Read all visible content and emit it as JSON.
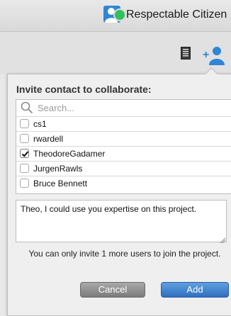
{
  "header": {
    "user_name": "Respectable Citizen",
    "status_color": "#2fc25b",
    "avatar_icon": "user-icon"
  },
  "toolbar": {
    "document_icon": "document-icon",
    "add_user_icon": "add-user-icon"
  },
  "invite_panel": {
    "title": "Invite contact to collaborate:",
    "search": {
      "placeholder": "Search...",
      "value": ""
    },
    "contacts": [
      {
        "name": "cs1",
        "checked": false
      },
      {
        "name": "rwardell",
        "checked": false
      },
      {
        "name": "TheodoreGadamer",
        "checked": true
      },
      {
        "name": "JurgenRawls",
        "checked": false
      },
      {
        "name": "Bruce Bennett",
        "checked": false
      }
    ],
    "message": "Theo, I could use you expertise on this project.",
    "limit_note": "You can only invite 1 more users to join the project.",
    "cancel_label": "Cancel",
    "add_label": "Add",
    "accent_color": "#2f6fc0"
  }
}
